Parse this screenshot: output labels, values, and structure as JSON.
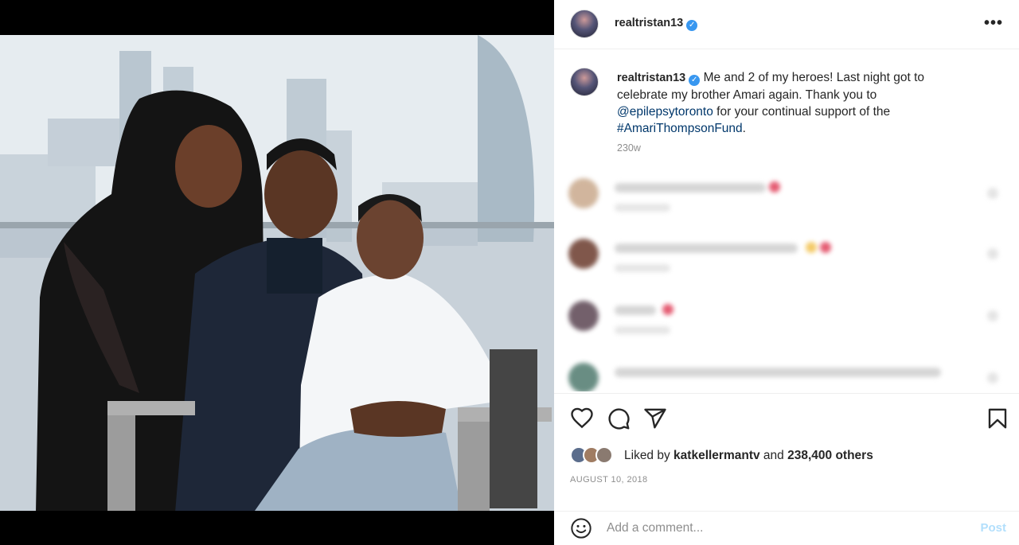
{
  "post": {
    "author": "realtristan13",
    "verified_mark": "✓",
    "more_icon": "•••",
    "caption": {
      "text_1": "Me and 2 of my heroes! Last night got to celebrate my brother Amari again. Thank you to",
      "mention": "@epilepsytoronto",
      "text_2": "for your continual support of the",
      "hashtag": "#AmariThompsonFund",
      "text_3": ".",
      "time": "230w"
    },
    "likes": {
      "prefix": "Liked by",
      "user": "katkellermantv",
      "joiner": "and",
      "others": "238,400 others"
    },
    "date": "AUGUST 10, 2018",
    "comment_input": {
      "placeholder": "Add a comment..."
    },
    "post_button": "Post",
    "colors": {
      "link": "#00376b",
      "verified": "#3897f0",
      "post_disabled": "#b2dffc"
    },
    "icons": [
      "heart-icon",
      "comment-icon",
      "share-icon",
      "bookmark-icon",
      "emoji-icon",
      "more-icon"
    ]
  }
}
